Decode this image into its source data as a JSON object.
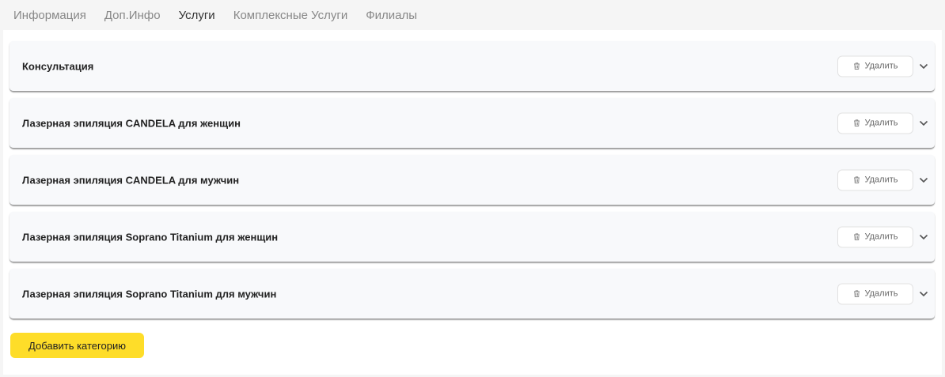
{
  "tabs": [
    {
      "label": "Информация",
      "active": false
    },
    {
      "label": "Доп.Инфо",
      "active": false
    },
    {
      "label": "Услуги",
      "active": true
    },
    {
      "label": "Комплексные Услуги",
      "active": false
    },
    {
      "label": "Филиалы",
      "active": false
    }
  ],
  "categories": [
    {
      "title": "Консультация",
      "delete_label": "Удалить"
    },
    {
      "title": "Лазерная эпиляция CANDELA для женщин",
      "delete_label": "Удалить"
    },
    {
      "title": "Лазерная эпиляция CANDELA для мужчин",
      "delete_label": "Удалить"
    },
    {
      "title": "Лазерная эпиляция Soprano Titanium для женщин",
      "delete_label": "Удалить"
    },
    {
      "title": "Лазерная эпиляция Soprano Titanium для мужчин",
      "delete_label": "Удалить"
    }
  ],
  "add_category_label": "Добавить категорию",
  "colors": {
    "accent_yellow": "#fedd29",
    "tab_active": "#333333",
    "tab_inactive": "#888888"
  },
  "icons": {
    "delete": "trash-icon",
    "expand": "chevron-down-icon"
  }
}
